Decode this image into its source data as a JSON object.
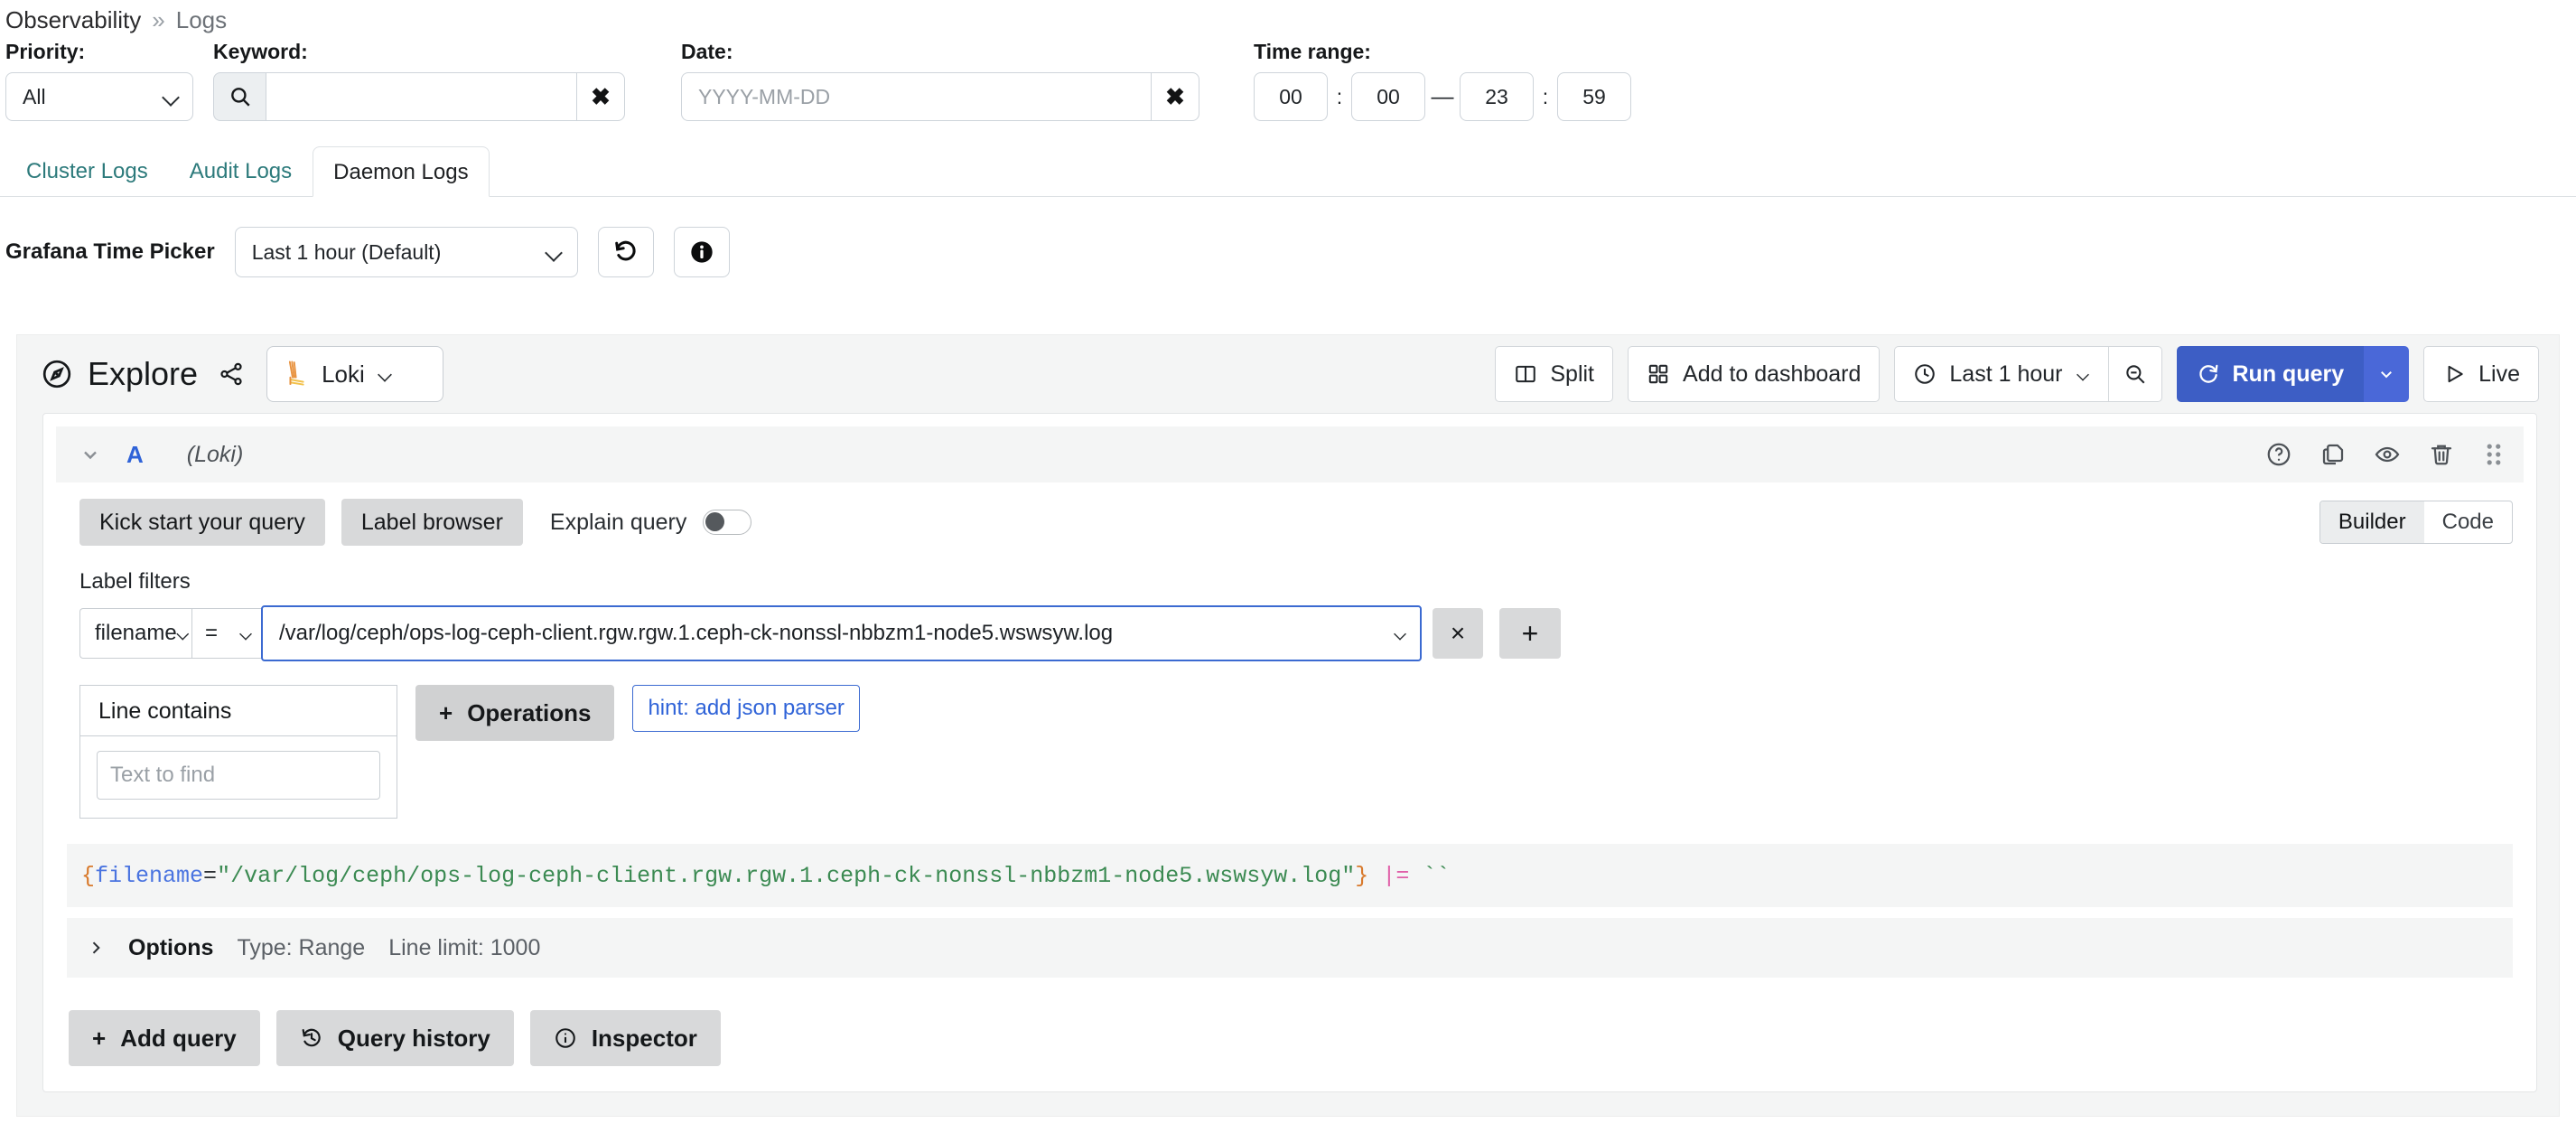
{
  "breadcrumb": {
    "root": "Observability",
    "separator": "»",
    "leaf": "Logs"
  },
  "filters": {
    "priority": {
      "label": "Priority:",
      "value": "All"
    },
    "keyword": {
      "label": "Keyword:",
      "value": "",
      "placeholder": "",
      "search_icon": "search-icon",
      "clear_icon": "✖"
    },
    "date": {
      "label": "Date:",
      "value": "",
      "placeholder": "YYYY-MM-DD",
      "clear_icon": "✖"
    },
    "time_range": {
      "label": "Time range:",
      "from_hour": "00",
      "from_minute": "00",
      "to_hour": "23",
      "to_minute": "59",
      "colon": ":",
      "dash": "—"
    }
  },
  "tabs": [
    {
      "label": "Cluster Logs",
      "active": false
    },
    {
      "label": "Audit Logs",
      "active": false
    },
    {
      "label": "Daemon Logs",
      "active": true
    }
  ],
  "grafana_time_picker": {
    "label": "Grafana Time Picker",
    "value": "Last 1 hour (Default)",
    "reset_icon": "reset-icon",
    "info_icon": "info-icon"
  },
  "explore": {
    "title": "Explore",
    "compass_icon": "compass-icon",
    "share_icon": "share-icon",
    "datasource": {
      "name": "Loki",
      "logo": "loki-logo-icon"
    },
    "toolbar": {
      "split": "Split",
      "add_to_dashboard": "Add to dashboard",
      "time_range": "Last 1 hour",
      "zoom_out_icon": "zoom-out-icon",
      "run_query": "Run query",
      "live": "Live"
    },
    "query_row": {
      "ref_id": "A",
      "datasource_note": "(Loki)",
      "icons": [
        "help-icon",
        "copy-icon",
        "eye-icon",
        "trash-icon",
        "drag-handle-icon"
      ],
      "kick_start": "Kick start your query",
      "label_browser": "Label browser",
      "explain_query": "Explain query",
      "explain_query_on": false,
      "mode": {
        "builder": "Builder",
        "code": "Code",
        "selected": "Builder"
      },
      "label_filters_title": "Label filters",
      "label_filter": {
        "key": "filename",
        "operator": "=",
        "value": "/var/log/ceph/ops-log-ceph-client.rgw.rgw.1.ceph-ck-nonssl-nbbzm1-node5.wswsyw.log",
        "remove_icon": "×",
        "add_icon": "+"
      },
      "line_contains": {
        "title": "Line contains",
        "value": "",
        "placeholder": "Text to find"
      },
      "operations_button": "Operations",
      "hint_button": "hint: add json parser",
      "query_preview": {
        "open_brace": "{",
        "label": "filename",
        "equals": "=",
        "string": "\"/var/log/ceph/ops-log-ceph-client.rgw.rgw.1.ceph-ck-nonssl-nbbzm1-node5.wswsyw.log\"",
        "close_brace": "}",
        "pipe_op": "|=",
        "backticks": "``"
      },
      "options": {
        "title": "Options",
        "type": "Type: Range",
        "line_limit": "Line limit: 1000"
      }
    },
    "bottom_buttons": {
      "add_query": "Add query",
      "query_history": "Query history",
      "inspector": "Inspector"
    }
  },
  "colors": {
    "accent_blue": "#3d5ec5",
    "link_teal": "#2c7a7b",
    "ref_blue": "#2f63d8",
    "panel_bg": "#f4f5f5"
  }
}
